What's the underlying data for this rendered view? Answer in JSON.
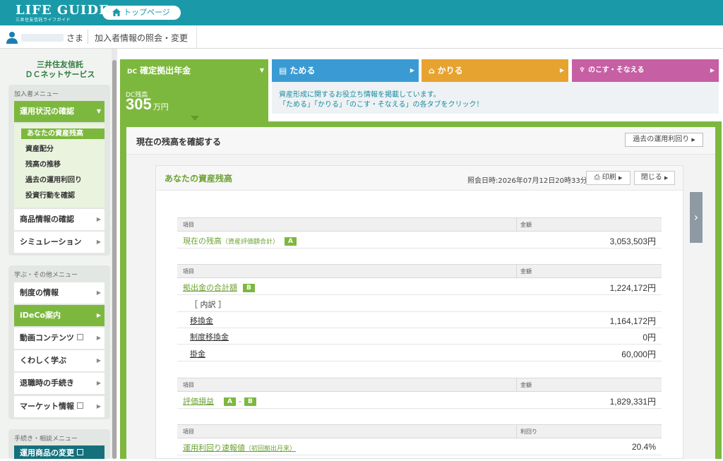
{
  "header": {
    "logo_main": "LIFE GUIDE",
    "logo_sub": "三井住友信託ライフガイド",
    "top_button": "トップページ",
    "user_suffix": "さま",
    "page_label": "加入者情報の照会・変更"
  },
  "sidebar": {
    "brand_line1": "三井住友信託",
    "brand_line2": "ＤＣネットサービス",
    "member_menu_title": "加入者メニュー",
    "member_items": [
      {
        "label": "運用状況の確認"
      },
      {
        "label": "商品情報の確認"
      },
      {
        "label": "シミュレーション"
      }
    ],
    "sub_items": [
      {
        "label": "あなたの資産残高"
      },
      {
        "label": "資産配分"
      },
      {
        "label": "残高の推移"
      },
      {
        "label": "過去の運用利回り"
      },
      {
        "label": "投資行動を確認"
      }
    ],
    "learn_menu_title": "学ぶ・その他メニュー",
    "learn_items": [
      {
        "label": "制度の情報"
      },
      {
        "label": "iDeCo案内"
      },
      {
        "label": "動画コンテンツ"
      },
      {
        "label": "くわしく学ぶ"
      },
      {
        "label": "退職時の手続き"
      },
      {
        "label": "マーケット情報"
      }
    ],
    "procedure_menu_title": "手続き・相談メニュー",
    "procedure_items": [
      {
        "label": "運用商品の変更"
      }
    ]
  },
  "tabs": {
    "dc": "確定拠出年金",
    "dc_icon_text": "DC",
    "tameru": "ためる",
    "kariru": "かりる",
    "nokosu": "のこす・そなえる"
  },
  "dc_panel": {
    "label": "DC残高",
    "value": "305",
    "unit": "万円"
  },
  "info": {
    "line1": "資産形成に関するお役立ち情報を掲載しています。",
    "line2": "「ためる」「かりる」「のこす・そなえる」の各タブをクリック！"
  },
  "main": {
    "section_title": "現在の残高を確認する",
    "past_button": "過去の運用利回り",
    "card_title": "あなたの資産残高",
    "date_label": "照会日時:2026年07月12日20時33分",
    "print_button": "印刷",
    "close_button": "閉じる"
  },
  "tables": {
    "head_item": "項目",
    "head_amount": "金額",
    "head_yield": "利回り",
    "balance": {
      "label": "現在の残高",
      "note": "（資産評価額合計）",
      "badge": "A",
      "value": "3,053,503円"
    },
    "contrib": {
      "label": "拠出金の合計額",
      "badge": "B",
      "value": "1,224,172円"
    },
    "breakdown_label": "［ 内訳 ］",
    "breakdown": [
      {
        "label": "移換金",
        "value": "1,164,172円"
      },
      {
        "label": "制度移換金",
        "value": "0円"
      },
      {
        "label": "掛金",
        "value": "60,000円"
      }
    ],
    "gain": {
      "label": "評価損益",
      "badge_a": "A",
      "minus": "-",
      "badge_b": "B",
      "value": "1,829,331円"
    },
    "yield": {
      "label": "運用利回り速報値",
      "note": "（初回拠出月来）",
      "value": "20.4%"
    }
  }
}
